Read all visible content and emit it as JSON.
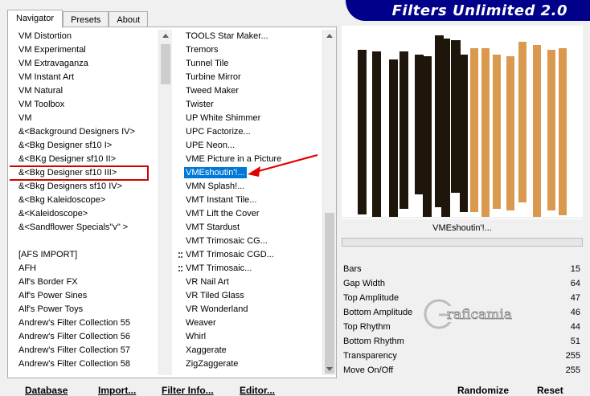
{
  "header": {
    "title": "Filters Unlimited 2.0"
  },
  "tabs": [
    {
      "label": "Navigator",
      "active": true
    },
    {
      "label": "Presets",
      "active": false
    },
    {
      "label": "About",
      "active": false
    }
  ],
  "categories": [
    {
      "label": "VM Distortion"
    },
    {
      "label": "VM Experimental"
    },
    {
      "label": "VM Extravaganza"
    },
    {
      "label": "VM Instant Art"
    },
    {
      "label": "VM Natural"
    },
    {
      "label": "VM Toolbox"
    },
    {
      "label": "VM"
    },
    {
      "label": "&<Background Designers IV>"
    },
    {
      "label": "&<Bkg Designer sf10 I>"
    },
    {
      "label": "&<BKg Designer sf10 II>"
    },
    {
      "label": "&<Bkg Designer sf10 III>",
      "selected": true
    },
    {
      "label": "&<Bkg Designers sf10 IV>"
    },
    {
      "label": "&<Bkg Kaleidoscope>"
    },
    {
      "label": "&<Kaleidoscope>"
    },
    {
      "label": "&<Sandflower Specials\"v\" >"
    },
    {
      "label": ""
    },
    {
      "label": "[AFS IMPORT]"
    },
    {
      "label": "AFH"
    },
    {
      "label": "Alf's Border FX"
    },
    {
      "label": "Alf's Power Sines"
    },
    {
      "label": "Alf's Power Toys"
    },
    {
      "label": "Andrew's Filter Collection 55"
    },
    {
      "label": "Andrew's Filter Collection 56"
    },
    {
      "label": "Andrew's Filter Collection 57"
    },
    {
      "label": "Andrew's Filter Collection 58"
    }
  ],
  "filters": [
    {
      "label": "TOOLS Star Maker..."
    },
    {
      "label": "Tremors"
    },
    {
      "label": "Tunnel Tile"
    },
    {
      "label": "Turbine Mirror"
    },
    {
      "label": "Tweed Maker"
    },
    {
      "label": "Twister"
    },
    {
      "label": "UP White Shimmer"
    },
    {
      "label": "UPC Factorize..."
    },
    {
      "label": "UPE Neon..."
    },
    {
      "label": "VME Picture in a Picture"
    },
    {
      "label": "VMEshoutin'!...",
      "selected": true
    },
    {
      "label": "VMN Splash!..."
    },
    {
      "label": "VMT Instant Tile..."
    },
    {
      "label": "VMT Lift the Cover"
    },
    {
      "label": "VMT Stardust"
    },
    {
      "label": "VMT Trimosaic CG..."
    },
    {
      "label": "VMT Trimosaic CGD...",
      "marked": true
    },
    {
      "label": "VMT Trimosaic...",
      "marked": true
    },
    {
      "label": "VR Nail Art"
    },
    {
      "label": "VR Tiled Glass"
    },
    {
      "label": "VR Wonderland"
    },
    {
      "label": "Weaver"
    },
    {
      "label": "Whirl"
    },
    {
      "label": "Xaggerate"
    },
    {
      "label": "ZigZaggerate"
    }
  ],
  "preview": {
    "filter_name": "VMEshoutin'!...",
    "dark_color": "#1e160b",
    "light_color": "#d99a4f"
  },
  "params": [
    {
      "label": "Bars",
      "value": "15"
    },
    {
      "label": "Gap Width",
      "value": "64"
    },
    {
      "label": "Top Amplitude",
      "value": "47"
    },
    {
      "label": "Bottom Amplitude",
      "value": "46"
    },
    {
      "label": "Top Rhythm",
      "value": "44"
    },
    {
      "label": "Bottom Rhythm",
      "value": "51"
    },
    {
      "label": "Transparency",
      "value": "255"
    },
    {
      "label": "Move On/Off",
      "value": "255"
    }
  ],
  "buttons": {
    "database": "Database",
    "import": "Import...",
    "filter_info": "Filter Info...",
    "editor": "Editor...",
    "randomize": "Randomize",
    "reset": "Reset"
  },
  "watermark": {
    "text": "raficamia",
    "initial": "G"
  }
}
